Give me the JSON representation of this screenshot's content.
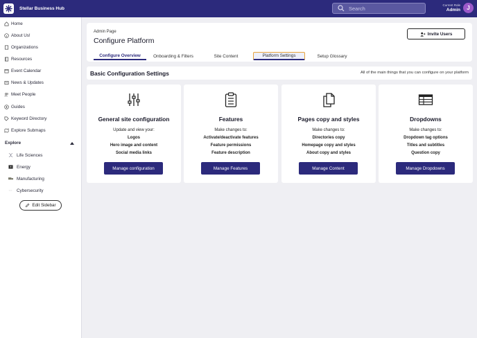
{
  "app": {
    "title": "Stellar Business Hub"
  },
  "search": {
    "placeholder": "Search"
  },
  "user": {
    "role_label": "Current Role",
    "role_value": "Admin",
    "avatar_initial": "J",
    "avatar_color": "#9b59c9"
  },
  "colors": {
    "brand": "#2c2a7c",
    "tab_highlight": "#e8a33c"
  },
  "sidebar": {
    "items": [
      {
        "label": "Home",
        "icon": "home-icon"
      },
      {
        "label": "About Us!",
        "icon": "info-icon"
      },
      {
        "label": "Organizations",
        "icon": "building-icon"
      },
      {
        "label": "Resources",
        "icon": "book-icon"
      },
      {
        "label": "Event Calendar",
        "icon": "calendar-icon"
      },
      {
        "label": "News & Updates",
        "icon": "news-icon"
      },
      {
        "label": "Meet People",
        "icon": "people-icon"
      },
      {
        "label": "Guides",
        "icon": "compass-icon"
      },
      {
        "label": "Keyword Directory",
        "icon": "tag-icon"
      },
      {
        "label": "Explore Submaps",
        "icon": "map-icon"
      }
    ],
    "explore_label": "Explore",
    "explore_items": [
      {
        "label": "Life Sciences",
        "icon": "dna-icon"
      },
      {
        "label": "Energy",
        "icon": "energy-icon"
      },
      {
        "label": "Manufacturing",
        "icon": "truck-icon"
      },
      {
        "label": "Cybersecurity",
        "icon": "dots-icon"
      }
    ],
    "edit_label": "Edit Sidebar"
  },
  "header": {
    "crumb": "Admin Page",
    "title": "Configure Platform",
    "invite_label": "Invite Users",
    "tabs": [
      {
        "label": "Configure Overview",
        "active": true
      },
      {
        "label": "Onboarding & Filters",
        "active": false
      },
      {
        "label": "Site Content",
        "active": false
      },
      {
        "label": "Platform Settings",
        "active": false,
        "highlighted": true
      },
      {
        "label": "Setup Glossary",
        "active": false
      }
    ]
  },
  "section": {
    "title": "Basic Configuration Settings",
    "description": "All of the main things that you can configure on your platform"
  },
  "cards": [
    {
      "icon": "sliders-icon",
      "title": "General site configuration",
      "intro": "Update and view your:",
      "lines": [
        "Logos",
        "Hero image and content",
        "Social media links"
      ],
      "button": "Manage configuration"
    },
    {
      "icon": "clipboard-list-icon",
      "title": "Features",
      "intro": "Make changes to:",
      "lines": [
        "Activate/deactivate features",
        "Feature permissions",
        "Feature description"
      ],
      "button": "Manage Features"
    },
    {
      "icon": "copy-icon",
      "title": "Pages copy and styles",
      "intro": "Make changes to:",
      "lines": [
        "Directories copy",
        "Homepage copy and styles",
        "About copy and styles"
      ],
      "button": "Manage Content"
    },
    {
      "icon": "table-icon",
      "title": "Dropdowns",
      "intro": "Make changes to:",
      "lines": [
        "Dropdown tag options",
        "Titles and subtitles",
        "Question copy"
      ],
      "button": "Manage Dropdowns"
    }
  ]
}
